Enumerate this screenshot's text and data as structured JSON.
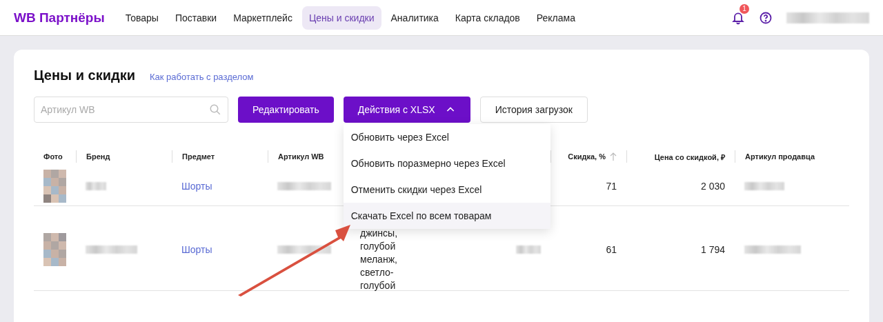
{
  "header": {
    "logo": "WB Партнёры",
    "nav": [
      {
        "label": "Товары",
        "selected": false
      },
      {
        "label": "Поставки",
        "selected": false
      },
      {
        "label": "Маркетплейс",
        "selected": false
      },
      {
        "label": "Цены и скидки",
        "selected": true
      },
      {
        "label": "Аналитика",
        "selected": false
      },
      {
        "label": "Карта складов",
        "selected": false
      },
      {
        "label": "Реклама",
        "selected": false
      }
    ],
    "notification_badge": "1"
  },
  "page": {
    "title": "Цены и скидки",
    "help_link": "Как работать с разделом"
  },
  "toolbar": {
    "search": {
      "placeholder": "Артикул WB"
    },
    "buttons": [
      {
        "label": "Редактировать",
        "kind": "primary"
      },
      {
        "label": "Действия с XLSX",
        "kind": "dropdown",
        "expanded": true
      },
      {
        "label": "История загрузок",
        "kind": "secondary"
      }
    ]
  },
  "xlsx_menu": [
    {
      "label": "Обновить через Excel",
      "highlighted": false
    },
    {
      "label": "Обновить поразмерно через Excel",
      "highlighted": false
    },
    {
      "label": "Отменить скидки через Excel",
      "highlighted": false
    },
    {
      "label": "Скачать Excel по всем товарам",
      "highlighted": true
    }
  ],
  "table": {
    "columns": [
      {
        "label": "Фото",
        "sorted": false
      },
      {
        "label": "Бренд",
        "sorted": false
      },
      {
        "label": "Предмет",
        "sorted": false
      },
      {
        "label": "Артикул WB",
        "sorted": false
      },
      {
        "label": "Скидка, %",
        "sorted": true
      },
      {
        "label": "Цена со скидкой, ₽",
        "sorted": false
      },
      {
        "label": "Артикул продавца",
        "sorted": false
      }
    ],
    "rows": [
      {
        "subject": "Шорты",
        "discount": "71",
        "price": "2 030"
      },
      {
        "subject": "Шорты",
        "column_5": "джинсы, голубой меланж, светло-голубой",
        "discount": "61",
        "price": "1 794"
      }
    ]
  }
}
